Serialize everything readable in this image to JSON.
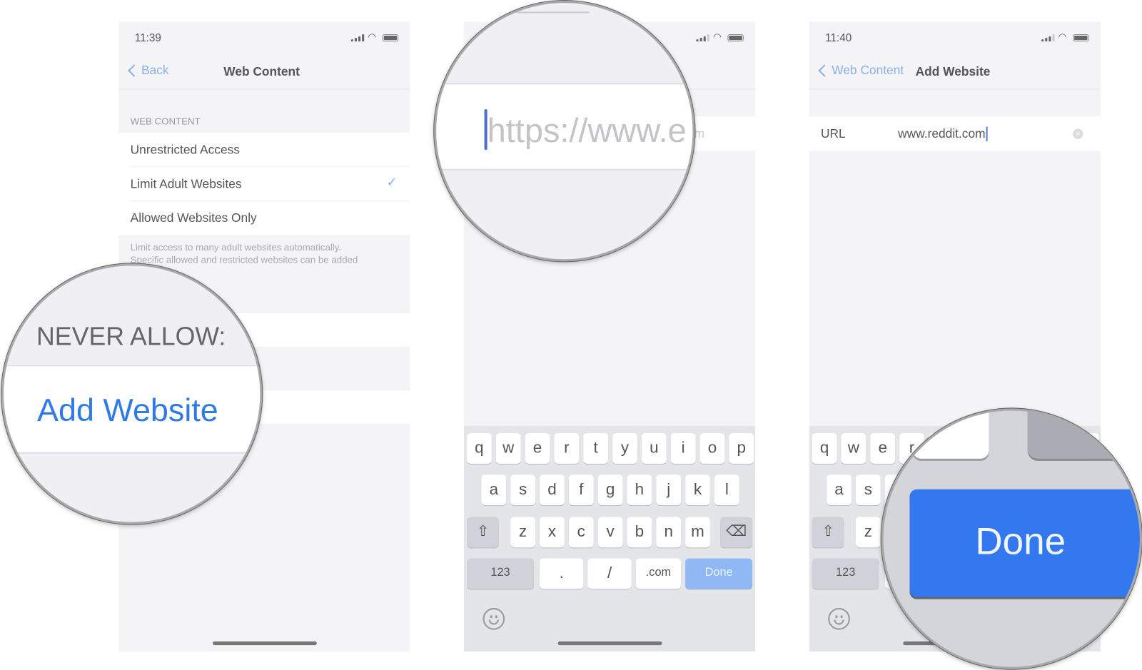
{
  "panel1": {
    "status_time": "11:39",
    "back_label": "Back",
    "title": "Web Content",
    "section_header": "WEB CONTENT",
    "options": [
      {
        "label": "Unrestricted Access",
        "selected": false
      },
      {
        "label": "Limit Adult Websites",
        "selected": true
      },
      {
        "label": "Allowed Websites Only",
        "selected": false
      }
    ],
    "check_glyph": "✓",
    "footer_line1": "Limit access to many adult websites automatically.",
    "footer_line2": "Specific allowed and restricted websites can be added",
    "magnifier": {
      "header": "NEVER ALLOW:",
      "action": "Add Website"
    }
  },
  "panel2": {
    "url_placeholder": "https://www.example.com",
    "magnifier_text": "https://www.e",
    "behind_text": "m"
  },
  "panel3": {
    "status_time": "11:40",
    "back_label": "Web Content",
    "title": "Add Website",
    "url_label": "URL",
    "url_value": "www.reddit.com",
    "magnifier_done": "Done"
  },
  "keyboard": {
    "row1": [
      "q",
      "w",
      "e",
      "r",
      "t",
      "y",
      "u",
      "i",
      "o",
      "p"
    ],
    "row2": [
      "a",
      "s",
      "d",
      "f",
      "g",
      "h",
      "j",
      "k",
      "l"
    ],
    "row3": [
      "z",
      "x",
      "c",
      "v",
      "b",
      "n",
      "m"
    ],
    "shift_icon": "shift-icon",
    "delete_icon": "delete-icon",
    "numbers_label": "123",
    "dot_label": ".",
    "slash_label": "/",
    "com_label": ".com",
    "done_label": "Done",
    "emoji_icon": "emoji-icon"
  },
  "colors": {
    "accent": "#2f7ae5",
    "link": "#8bb0e6",
    "done_disabled": "#8fb8f5",
    "done_active": "#3478f0"
  }
}
